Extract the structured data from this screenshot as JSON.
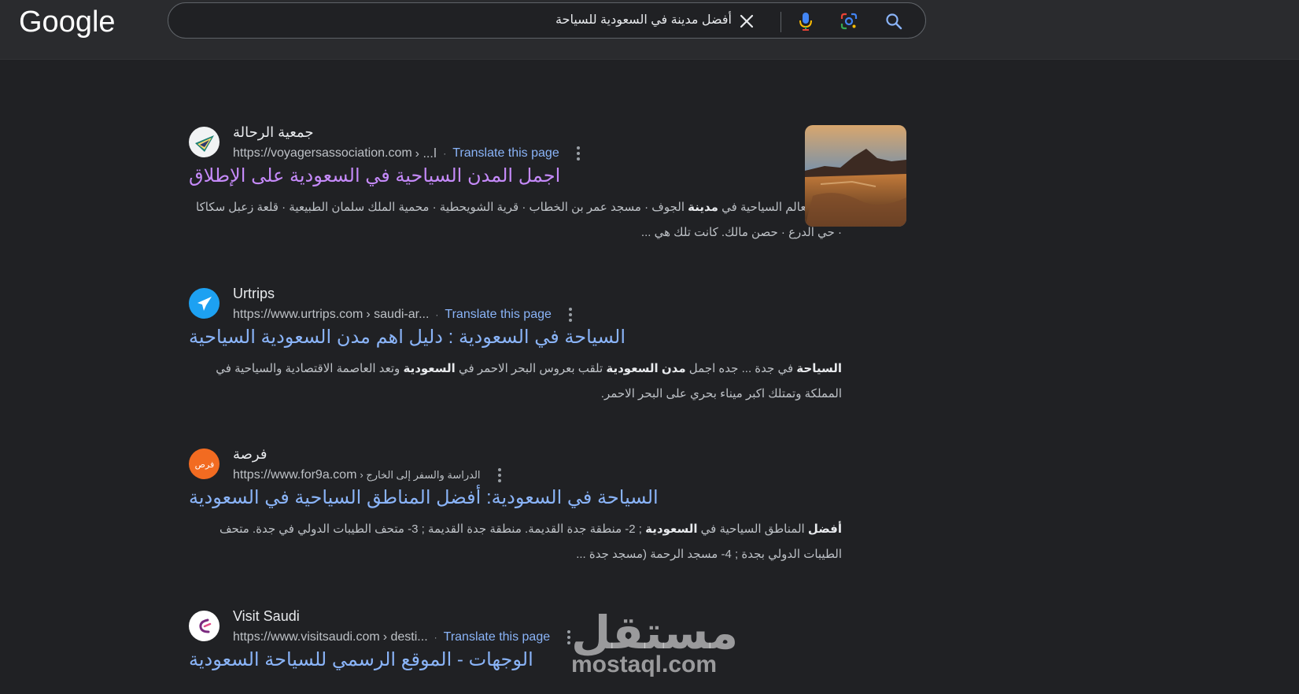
{
  "header": {
    "logo_text": "Google",
    "search_query": "أفضل مدينة في السعودية للسياحة"
  },
  "results": [
    {
      "site_name": "جمعية الرحالة",
      "url": "https://voyagersassociation.com",
      "crumb": "› ...ا",
      "translate": "Translate this page",
      "title": "اجمل المدن السياحية في السعودية على الإطلاق",
      "snippet_parts": [
        {
          "text": "أبرز المعالم السياحية في ",
          "bold": false
        },
        {
          "text": "مدينة",
          "bold": true
        },
        {
          "text": " الجوف · مسجد عمر بن الخطاب · قرية الشويحطية · محمية الملك سلمان الطبيعية · قلعة زعبل سكاكا · حي الدرع · حصن مالك. كانت تلك هي ...",
          "bold": false
        }
      ]
    },
    {
      "site_name": "Urtrips",
      "url": "https://www.urtrips.com",
      "crumb": "› saudi-ar...",
      "translate": "Translate this page",
      "title": "السياحة في السعودية : دليل اهم مدن السعودية السياحية",
      "snippet_parts": [
        {
          "text": "السياحة",
          "bold": true
        },
        {
          "text": " في جدة ... جده اجمل ",
          "bold": false
        },
        {
          "text": "مدن السعودية",
          "bold": true
        },
        {
          "text": " تلقب بعروس البحر الاحمر في ",
          "bold": false
        },
        {
          "text": "السعودية",
          "bold": true
        },
        {
          "text": " وتعد العاصمة الاقتصادية والسياحية في المملكة وتمتلك اكبر ميناء بحري على البحر الاحمر.",
          "bold": false
        }
      ]
    },
    {
      "site_name": "فرصة",
      "url": "https://www.for9a.com",
      "crumb": "› الدراسة والسفر إلى الخارج",
      "translate": "",
      "title": "السياحة في السعودية: أفضل المناطق السياحية في السعودية",
      "snippet_parts": [
        {
          "text": "أفضل",
          "bold": true
        },
        {
          "text": " المناطق السياحية في ",
          "bold": false
        },
        {
          "text": "السعودية",
          "bold": true
        },
        {
          "text": " ; 2- منطقة جدة القديمة. منطقة جدة القديمة ; 3- متحف الطيبات الدولي في جدة. متحف الطيبات الدولي بجدة ; 4- مسجد الرحمة (مسجد جدة ...",
          "bold": false
        }
      ]
    },
    {
      "site_name": "Visit Saudi",
      "url": "https://www.visitsaudi.com",
      "crumb": "› desti...",
      "translate": "Translate this page",
      "title": "الوجهات - الموقع الرسمي للسياحة السعودية",
      "snippet_parts": []
    }
  ],
  "watermark": {
    "arabic": "مستقل",
    "latin": "mostaql.com"
  },
  "icons": [
    "clear-icon",
    "microphone-icon",
    "google-lens-icon",
    "search-icon",
    "more-options-icon"
  ],
  "colors": {
    "background": "#202124",
    "header": "#2a2b2e",
    "link": "#8ab4f8",
    "visited_link": "#c58af9",
    "text": "#bdc1c6"
  }
}
